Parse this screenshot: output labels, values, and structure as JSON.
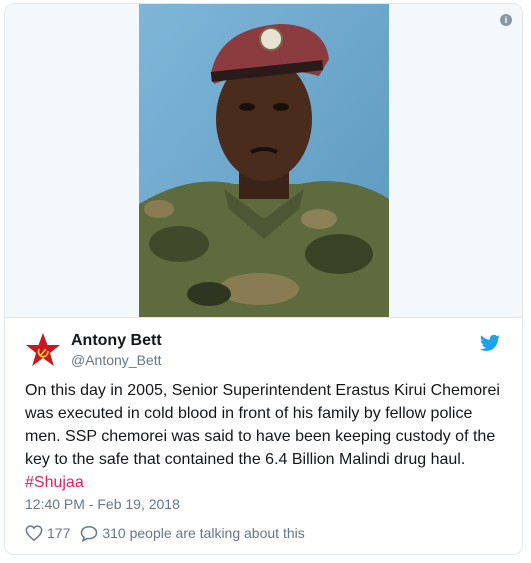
{
  "media": {
    "photo_alt": "",
    "info_icon": "info-icon",
    "info_glyph": "i"
  },
  "author": {
    "name": "Antony Bett",
    "handle": "@Antony_Bett",
    "avatar_icon": "star-hammer-sickle-icon"
  },
  "brand": {
    "icon": "twitter-bird-icon",
    "color": "#1da1f2"
  },
  "tweet": {
    "text": "On this day in 2005, Senior Superintendent Erastus Kirui Chemorei was executed in cold blood in front of his family by fellow police men. SSP chemorei was said to have been keeping custody of the key to the safe that contained the 6.4 Billion Malindi drug haul.",
    "hashtag": "#Shujaa",
    "hashtag_color": "#e0245e",
    "timestamp": "12:40 PM - Feb 19, 2018"
  },
  "actions": {
    "likes_count": "177",
    "like_icon": "heart-icon",
    "reply_icon": "speech-bubble-icon",
    "conversation_label": "310 people are talking about this"
  }
}
